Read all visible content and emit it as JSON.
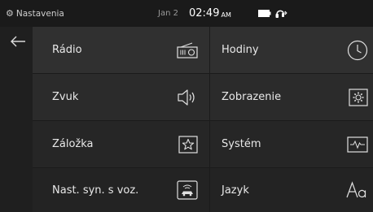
{
  "status_bar": {
    "title": "Nastavenia",
    "date": "Jan 2",
    "time": "02:49",
    "ampm": "AM",
    "icons": [
      "settings-icon",
      "battery-icon",
      "bluetooth-headset-icon"
    ]
  },
  "navigation": {
    "back_icon": "back-arrow-icon"
  },
  "menu": {
    "items": [
      {
        "label": "Rádio",
        "icon": "radio-icon"
      },
      {
        "label": "Hodiny",
        "icon": "clock-icon"
      },
      {
        "label": "Zvuk",
        "icon": "speaker-icon"
      },
      {
        "label": "Zobrazenie",
        "icon": "display-settings-icon"
      },
      {
        "label": "Záložka",
        "icon": "star-bookmark-icon"
      },
      {
        "label": "Systém",
        "icon": "system-monitor-icon"
      },
      {
        "label": "Nast. syn. s voz.",
        "icon": "vehicle-sync-icon"
      },
      {
        "label": "Jazyk",
        "icon": "language-icon"
      }
    ]
  },
  "colors": {
    "background": "#1b1b1b",
    "tile_top": "#303030",
    "tile_bottom": "#232323",
    "text": "#e8e8e8"
  }
}
